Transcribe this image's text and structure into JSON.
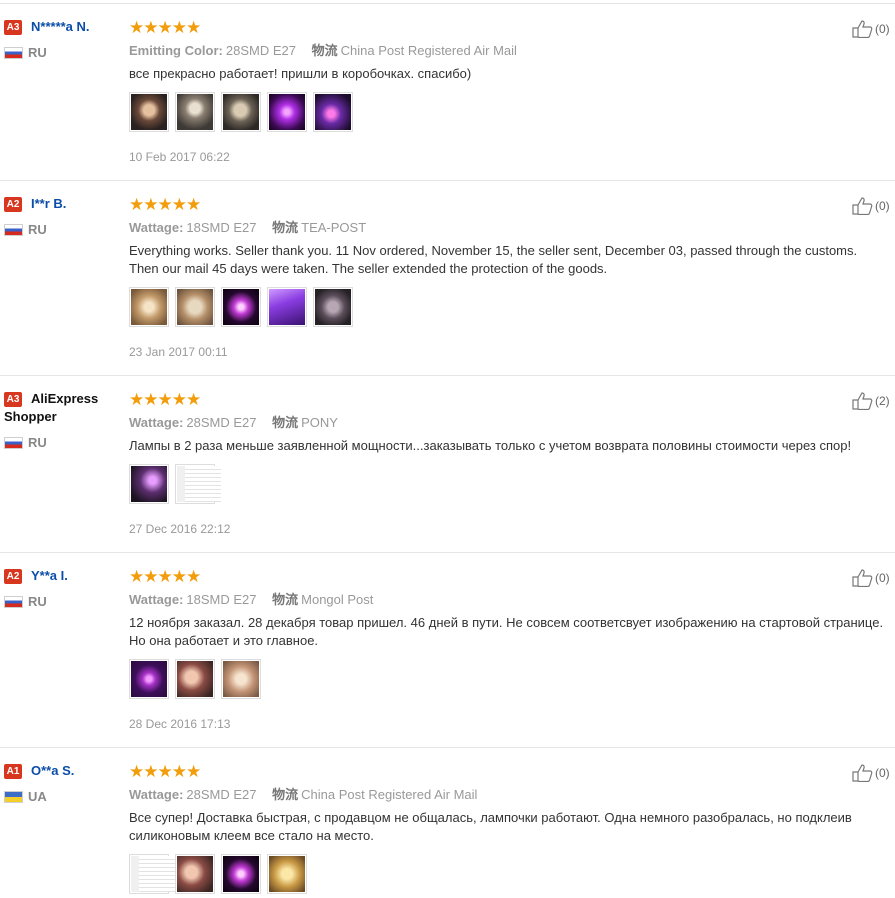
{
  "reviews": [
    {
      "level": "A3",
      "name": "N*****a N.",
      "country": "RU",
      "flag": "ru",
      "stars": "★★★★★",
      "attr_label": "Emitting Color:",
      "attr_value": "28SMD E27",
      "logistics_label": "物流",
      "logistics_value": "China Post Registered Air Mail",
      "text": "все прекрасно работает! пришли в коробочках. спасибо)",
      "photos": [
        "p-dark1",
        "p-lamp",
        "p-lamp2",
        "p-purple",
        "p-purple2"
      ],
      "date": "10 Feb 2017 06:22",
      "helpful": "(0)"
    },
    {
      "level": "A2",
      "name": "I**r B.",
      "country": "RU",
      "flag": "ru",
      "stars": "★★★★★",
      "attr_label": "Wattage:",
      "attr_value": "18SMD E27",
      "logistics_label": "物流",
      "logistics_value": "TEA-POST",
      "text": "Everything works. Seller thank you. 11 Nov ordered, November 15, the seller sent, December 03, passed through the customs. Then our mail 45 days were taken. The seller extended the protection of the goods.",
      "photos": [
        "p-gold",
        "p-gold2",
        "p-purpleb",
        "p-violet",
        "p-greydisc"
      ],
      "date": "23 Jan 2017 00:11",
      "helpful": "(0)"
    },
    {
      "level": "A3",
      "name": "AliExpress Shopper",
      "country": "RU",
      "flag": "ru",
      "stars": "★★★★★",
      "attr_label": "Wattage:",
      "attr_value": "28SMD E27",
      "logistics_label": "物流",
      "logistics_value": "PONY",
      "text": "Лампы в 2 раза меньше заявленной мощности...заказывать только с учетом возврата половины стоимости через спор!",
      "photos": [
        "p-phone",
        "p-doc"
      ],
      "date": "27 Dec 2016 22:12",
      "helpful": "(2)"
    },
    {
      "level": "A2",
      "name": "Y**a I.",
      "country": "RU",
      "flag": "ru",
      "stars": "★★★★★",
      "attr_label": "Wattage:",
      "attr_value": "18SMD E27",
      "logistics_label": "物流",
      "logistics_value": "Mongol Post",
      "text": "12 ноября заказал. 28 декабря товар пришел. 46 дней в пути. Не совсем соответсвует изображению на стартовой странице. Но она работает и это главное.",
      "photos": [
        "p-disc",
        "p-mixed",
        "p-hand"
      ],
      "date": "28 Dec 2016 17:13",
      "helpful": "(0)"
    },
    {
      "level": "A1",
      "name": "O**a S.",
      "country": "UA",
      "flag": "ua",
      "stars": "★★★★★",
      "attr_label": "Wattage:",
      "attr_value": "28SMD E27",
      "logistics_label": "物流",
      "logistics_value": "China Post Registered Air Mail",
      "text": "Все супер! Доставка быстрая, с продавцом не общалась, лампочки работают. Одна немного разобралась, но подклеив силиконовым клеем все стало на место.",
      "photos": [
        "p-doc",
        "p-mixed",
        "p-purpleb",
        "p-gold3"
      ],
      "date": "",
      "helpful": "(0)"
    }
  ]
}
